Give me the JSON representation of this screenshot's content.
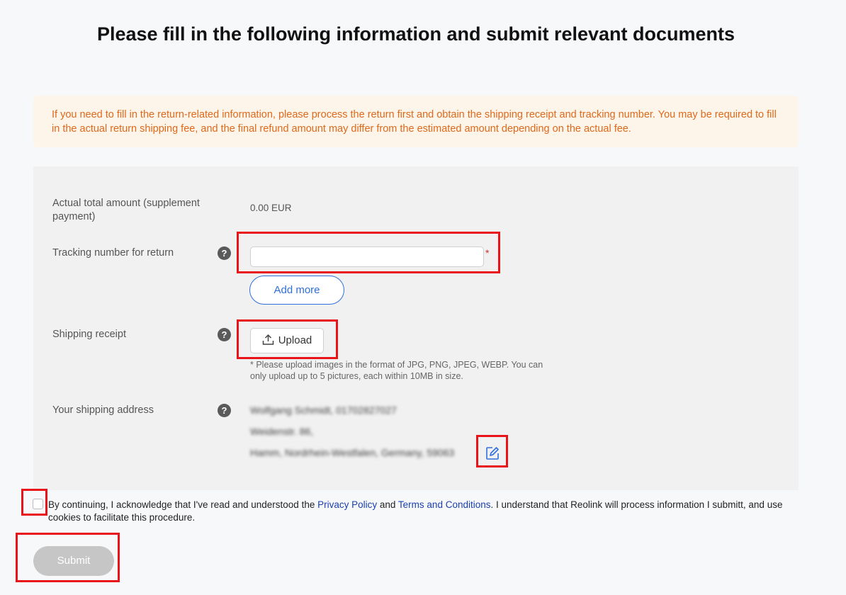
{
  "page": {
    "title": "Please fill in the following information and submit relevant documents"
  },
  "notice": {
    "text": "If you need to fill in the return-related information, please process the return first and obtain the shipping receipt and tracking number. You may be required to fill in the actual return shipping fee, and the final refund amount may differ from the estimated amount depending on the actual fee."
  },
  "form": {
    "amount_label": "Actual total amount (supplement payment)",
    "amount_value": "0.00 EUR",
    "tracking_label": "Tracking number for return",
    "tracking_value": "",
    "tracking_placeholder": "",
    "required_mark": "*",
    "add_more_label": "Add more",
    "receipt_label": "Shipping receipt",
    "upload_label": "Upload",
    "upload_hint": "* Please upload images in the format of JPG, PNG, JPEG, WEBP. You can only upload up to 5 pictures, each within 10MB in size.",
    "address_label": "Your shipping address",
    "help_symbol": "?",
    "address_lines": [
      "Wolfgang Schmidt, 01702827027",
      "Weidenstr. 86,",
      "Hamm, Nordrhein-Westfalen, Germany, 59063"
    ]
  },
  "consent": {
    "text_before": "By continuing, I acknowledge that I've read and understood the ",
    "privacy_link": "Privacy Policy",
    "text_and": " and ",
    "terms_link": "Terms and Conditions",
    "text_after": ". I understand that Reolink will process information I submitt, and use cookies to facilitate this procedure.",
    "checked": false
  },
  "submit_label": "Submit",
  "colors": {
    "accent": "#2f6fdc",
    "notice_text": "#e0691a",
    "highlight": "#e8141a",
    "submit_disabled": "#c6c6c6"
  }
}
